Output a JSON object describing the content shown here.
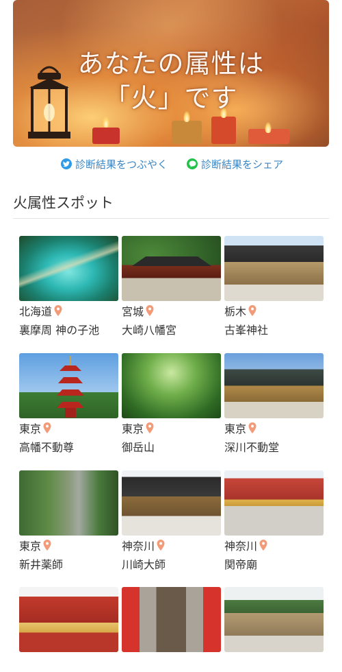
{
  "hero": {
    "line1": "あなたの属性は",
    "line2": "「火」です"
  },
  "share": {
    "twitter_label": "診断結果をつぶやく",
    "line_label": "診断結果をシェア"
  },
  "section": {
    "title": "火属性スポット"
  },
  "spots": [
    {
      "prefecture": "北海道",
      "name": "裏摩周 神の子池"
    },
    {
      "prefecture": "宮城",
      "name": "大崎八幡宮"
    },
    {
      "prefecture": "栃木",
      "name": "古峯神社"
    },
    {
      "prefecture": "東京",
      "name": "高幡不動尊"
    },
    {
      "prefecture": "東京",
      "name": "御岳山"
    },
    {
      "prefecture": "東京",
      "name": "深川不動堂"
    },
    {
      "prefecture": "東京",
      "name": "新井薬師"
    },
    {
      "prefecture": "神奈川",
      "name": "川崎大師"
    },
    {
      "prefecture": "神奈川",
      "name": "関帝廟"
    },
    {
      "prefecture": "",
      "name": ""
    },
    {
      "prefecture": "",
      "name": ""
    },
    {
      "prefecture": "",
      "name": ""
    }
  ],
  "colors": {
    "link": "#3a86c4",
    "twitter": "#2f9be8",
    "line": "#23c14a",
    "pin": "#f29b78"
  }
}
